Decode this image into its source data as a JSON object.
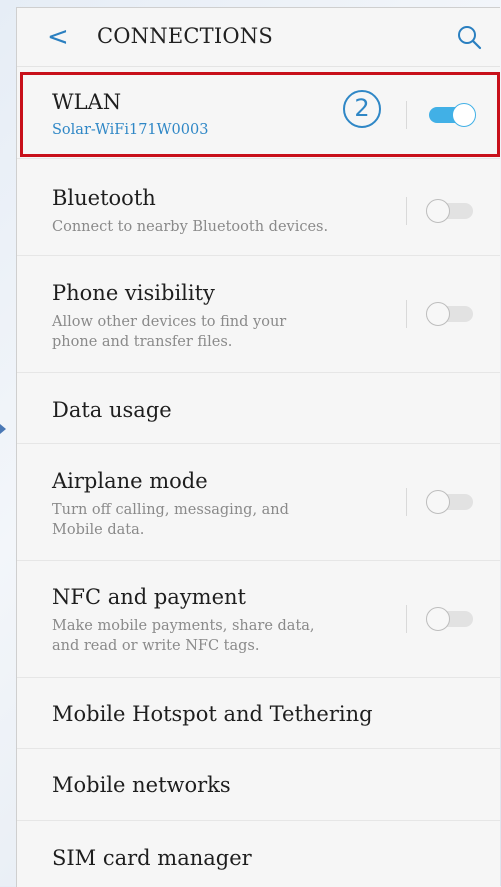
{
  "header": {
    "back_glyph": "<",
    "title": "CONNECTIONS",
    "search_icon": "search-icon"
  },
  "annotation": {
    "step_marker": "2",
    "highlight_color": "#c8101a"
  },
  "items": [
    {
      "label": "WLAN",
      "subtitle": "Solar-WiFi171W0003",
      "toggle": true
    },
    {
      "label": "Bluetooth",
      "subtitle": "Connect to nearby Bluetooth devices.",
      "toggle": false
    },
    {
      "label": "Phone visibility",
      "subtitle_lines": [
        "Allow other devices to find your",
        "phone and transfer files."
      ],
      "toggle": false
    },
    {
      "label": "Data usage"
    },
    {
      "label": "Airplane mode",
      "subtitle_lines": [
        "Turn off calling, messaging, and",
        "Mobile data."
      ],
      "toggle": false
    },
    {
      "label": "NFC and payment",
      "subtitle_lines": [
        "Make mobile payments, share data,",
        "and read or write NFC tags."
      ],
      "toggle": false
    },
    {
      "label": "Mobile Hotspot and Tethering"
    },
    {
      "label": "Mobile networks"
    },
    {
      "label": "SIM card manager"
    }
  ],
  "colors": {
    "accent": "#41b0e6",
    "link_blue": "#2f87c6"
  }
}
